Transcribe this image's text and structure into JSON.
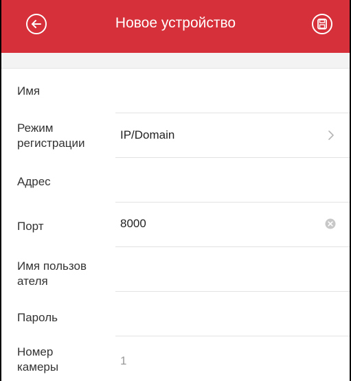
{
  "header": {
    "title": "Новое устройство",
    "back_icon": "back-arrow-icon",
    "save_icon": "save-icon",
    "accent_color": "#d6303a"
  },
  "form": {
    "name_label": "Имя",
    "mode_label": "Режим регистрации",
    "mode_value": "IP/Domain",
    "address_label": "Адрес",
    "port_label": "Порт",
    "port_value": "8000",
    "username_label": "Имя пользов ателя",
    "password_label": "Пароль",
    "camera_label": "Номер камеры",
    "camera_value": "1"
  }
}
